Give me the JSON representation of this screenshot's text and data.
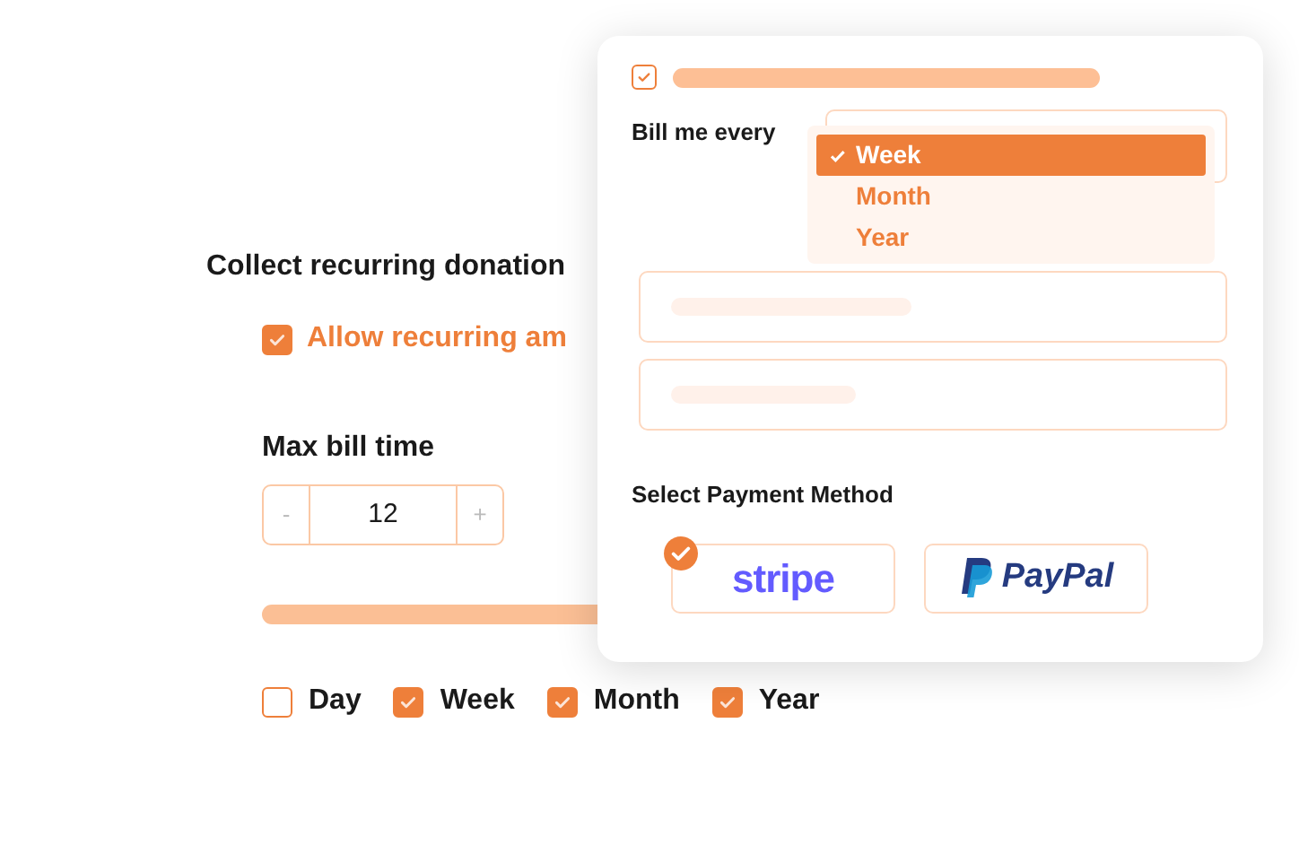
{
  "settings": {
    "heading": "Collect recurring donation",
    "allow_recurring": {
      "label": "Allow recurring am",
      "checked": true
    },
    "max_bill_time": {
      "label": "Max bill time",
      "minus": "-",
      "value": "12",
      "plus": "+"
    },
    "periods": [
      {
        "label": "Day",
        "checked": false
      },
      {
        "label": "Week",
        "checked": true
      },
      {
        "label": "Month",
        "checked": true
      },
      {
        "label": "Year",
        "checked": true
      }
    ]
  },
  "form_card": {
    "top_checkbox": {
      "checked": true
    },
    "bill_label": "Bill me every",
    "options": [
      {
        "label": "Week",
        "selected": true
      },
      {
        "label": "Month",
        "selected": false
      },
      {
        "label": "Year",
        "selected": false
      }
    ],
    "payment_label": "Select Payment Method",
    "payment_methods": [
      {
        "kind": "stripe",
        "label": "stripe",
        "selected": true
      },
      {
        "kind": "paypal",
        "label": "PayPal",
        "selected": false
      }
    ]
  }
}
